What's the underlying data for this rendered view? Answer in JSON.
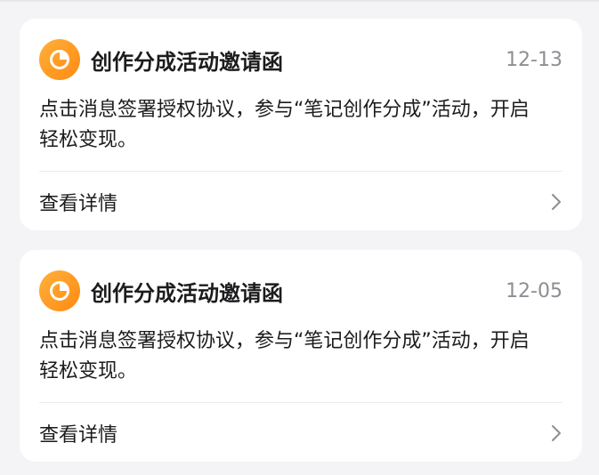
{
  "messages": [
    {
      "title": "创作分成活动邀请函",
      "date": "12-13",
      "body": "点击消息签署授权协议，参与“笔记创作分成”活动，开启轻松变现。",
      "link_label": "查看详情",
      "icon": "pie-chart-icon"
    },
    {
      "title": "创作分成活动邀请函",
      "date": "12-05",
      "body": "点击消息签署授权协议，参与“笔记创作分成”活动，开启轻松变现。",
      "link_label": "查看详情",
      "icon": "pie-chart-icon"
    }
  ],
  "colors": {
    "background": "#f4f4f6",
    "card": "#ffffff",
    "accent": "#ff9a1f",
    "title_text": "#1c1c1e",
    "secondary_text": "#8e8e93"
  }
}
